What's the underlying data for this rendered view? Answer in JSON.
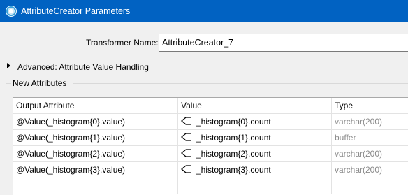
{
  "window": {
    "title": "AttributeCreator Parameters"
  },
  "form": {
    "transformer_name_label": "Transformer Name:",
    "transformer_name_value": "AttributeCreator_7",
    "advanced_label": "Advanced: Attribute Value Handling"
  },
  "new_attributes": {
    "group_label": "New Attributes",
    "columns": [
      "Output Attribute",
      "Value",
      "Type"
    ],
    "rows": [
      {
        "output": "@Value(_histogram{0}.value)",
        "value": "_histogram{0}.count",
        "type": "varchar(200)"
      },
      {
        "output": "@Value(_histogram{1}.value)",
        "value": "_histogram{1}.count",
        "type": "buffer"
      },
      {
        "output": "@Value(_histogram{2}.value)",
        "value": "_histogram{2}.count",
        "type": "varchar(200)"
      },
      {
        "output": "@Value(_histogram{3}.value)",
        "value": "_histogram{3}.count",
        "type": "varchar(200)"
      }
    ]
  },
  "colors": {
    "titlebar": "#0162c2",
    "type_text": "#8a8a8a"
  },
  "icons": {
    "app": "fme-transformer-icon",
    "value": "attribute-value-icon",
    "expander": "triangle-right-icon"
  }
}
